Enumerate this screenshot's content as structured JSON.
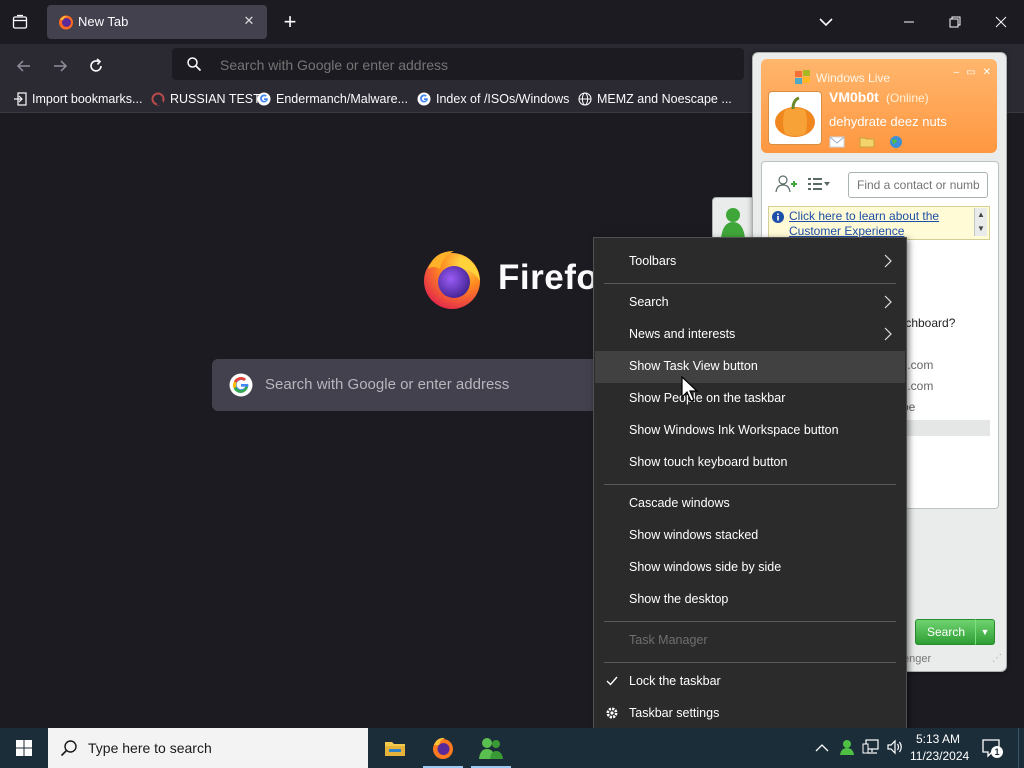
{
  "firefox": {
    "tab_title": "New Tab",
    "urlbar_placeholder": "Search with Google or enter address",
    "bookmarks": [
      {
        "label": "Import bookmarks...",
        "icon": "import-icon"
      },
      {
        "label": "RUSSIAN TEST",
        "icon": "site-favicon"
      },
      {
        "label": "Endermanch/Malware...",
        "icon": "google-icon"
      },
      {
        "label": "Index of /ISOs/Windows",
        "icon": "google-icon"
      },
      {
        "label": "MEMZ and Noescape ...",
        "icon": "globe-icon"
      }
    ],
    "wordmark": "Firefox",
    "ntp_search_placeholder": "Search with Google or enter address"
  },
  "messenger": {
    "title": "Windows Live",
    "username": "VM0b0t",
    "status": "(Online)",
    "personal_message": "dehydrate deez nuts",
    "find_placeholder": "Find a contact or number",
    "info_link": "Click here to learn about the Customer Experience",
    "partial_lines": [
      "tchboard?",
      "il.com",
      "il.com",
      "be"
    ],
    "search_button": "Search",
    "footer_partial": "enger"
  },
  "context_menu": {
    "items": [
      {
        "label": "Toolbars",
        "submenu": true
      },
      {
        "label": "Search",
        "submenu": true
      },
      {
        "label": "News and interests",
        "submenu": true
      },
      {
        "label": "Show Task View button",
        "hovered": true
      },
      {
        "label": "Show People on the taskbar"
      },
      {
        "label": "Show Windows Ink Workspace button"
      },
      {
        "label": "Show touch keyboard button"
      },
      {
        "label": "Cascade windows"
      },
      {
        "label": "Show windows stacked"
      },
      {
        "label": "Show windows side by side"
      },
      {
        "label": "Show the desktop"
      },
      {
        "label": "Task Manager",
        "disabled": true
      },
      {
        "label": "Lock the taskbar",
        "checked": true
      },
      {
        "label": "Taskbar settings",
        "icon": "gear-icon"
      }
    ]
  },
  "taskbar": {
    "search_placeholder": "Type here to search",
    "time": "5:13 AM",
    "date": "11/23/2024",
    "notification_count": "1"
  },
  "colors": {
    "firefox_bg": "#1c1b22",
    "firefox_toolbar": "#2b2a33",
    "menu_bg": "#2b2b2b",
    "menu_hover": "#414141",
    "taskbar": "#1c2d3a",
    "messenger_orange": "#ff9740"
  }
}
